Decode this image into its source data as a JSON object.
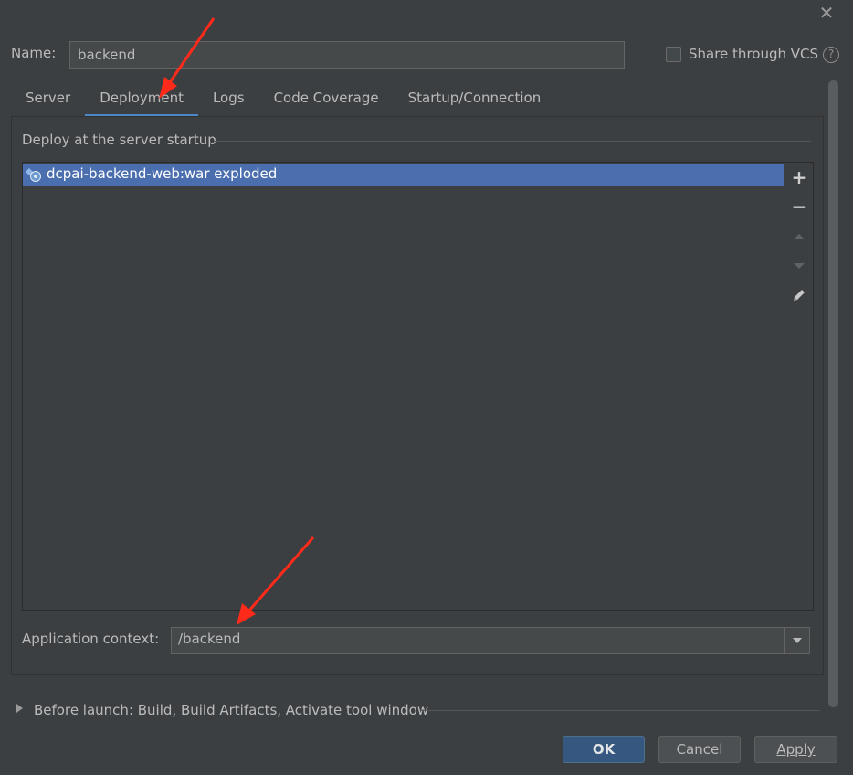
{
  "dialog": {
    "close_icon": "close-icon"
  },
  "name_field": {
    "label": "Name:",
    "value": "backend"
  },
  "vcs": {
    "label": "Share through VCS",
    "checked": false,
    "help": "?"
  },
  "tabs": [
    {
      "label": "Server",
      "active": false
    },
    {
      "label": "Deployment",
      "active": true
    },
    {
      "label": "Logs",
      "active": false
    },
    {
      "label": "Code Coverage",
      "active": false
    },
    {
      "label": "Startup/Connection",
      "active": false
    }
  ],
  "deployment": {
    "group_title": "Deploy at the server startup",
    "items": [
      {
        "label": "dcpai-backend-web:war exploded",
        "icon": "artifact-icon",
        "selected": true
      }
    ],
    "toolbar": {
      "add": "+",
      "remove": "−"
    },
    "context": {
      "label": "Application context:",
      "value": "/backend"
    }
  },
  "before_launch": {
    "label": "Before launch: Build, Build Artifacts, Activate tool window"
  },
  "buttons": {
    "ok": "OK",
    "cancel": "Cancel",
    "apply": "Apply"
  },
  "colors": {
    "accent": "#4a88c7",
    "selection": "#4b6eaf",
    "annotation_arrow": "#ff2a1a"
  }
}
